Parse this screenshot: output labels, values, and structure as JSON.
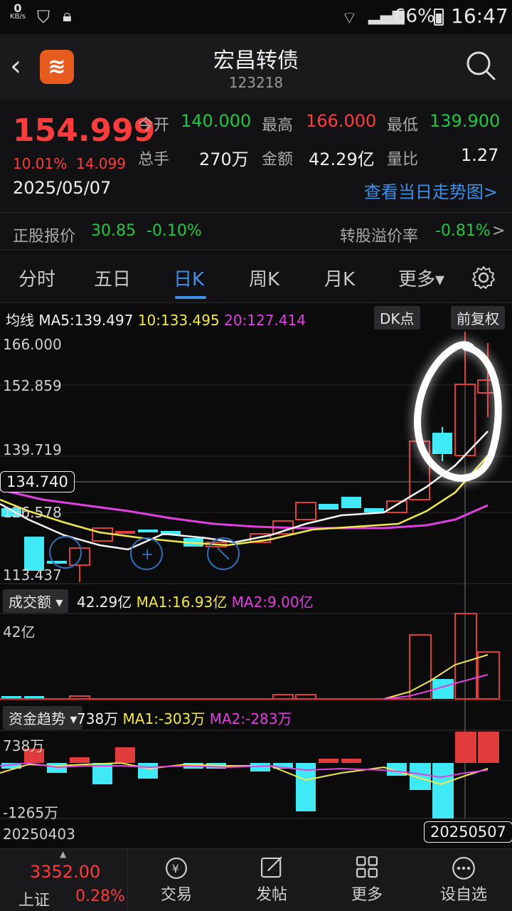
{
  "status": {
    "speed_value": "0",
    "speed_unit": "KB/s",
    "battery": "66%",
    "time": "16:47"
  },
  "header": {
    "title": "宏昌转债",
    "code": "123218"
  },
  "quote": {
    "price": "154.999",
    "change_pct": "10.01%",
    "change_amt": "14.099",
    "date": "2025/05/07",
    "open_label": "今开",
    "open": "140.000",
    "high_label": "最高",
    "high": "166.000",
    "low_label": "最低",
    "low": "139.900",
    "volume_label": "总手",
    "volume": "270万",
    "amount_label": "金额",
    "amount": "42.29亿",
    "ratio_label": "量比",
    "ratio": "1.27",
    "intraday_link": "查看当日走势图>",
    "stock_label": "正股报价",
    "stock_price": "30.85",
    "stock_change": "-0.10%",
    "premium_label": "转股溢价率",
    "premium": "-0.81%",
    "premium_arrow": ">"
  },
  "tabs": [
    {
      "label": "分时"
    },
    {
      "label": "五日"
    },
    {
      "label": "日K"
    },
    {
      "label": "周K"
    },
    {
      "label": "月K"
    },
    {
      "label": "更多▾"
    }
  ],
  "chart": {
    "ma_prefix": "均线",
    "ma5": "MA5:139.497",
    "ma10": "10:133.495",
    "ma20": "20:127.414",
    "dk_button": "DK点",
    "adjust_button": "前复权",
    "axis_labels": [
      "166.000",
      "152.859",
      "139.719",
      "126.578",
      "113.437"
    ],
    "crosshair_price": "134.740",
    "vol_selector": "成交额 ▾",
    "vol_value": "42.29亿",
    "vol_ma1": "MA1:16.93亿",
    "vol_ma2": "MA2:9.00亿",
    "vol_axis_top": "42亿",
    "flow_selector": "资金趋势 ▾",
    "flow_value": "738万",
    "flow_ma1": "MA1:-303万",
    "flow_ma2": "MA2:-283万",
    "flow_axis_top": "738万",
    "flow_axis_bottom": "-1265万",
    "date_start": "20250403",
    "date_end": "20250507"
  },
  "bottom": {
    "index_value": "3352.00",
    "index_name": "上证",
    "index_change": "0.28%",
    "items": [
      {
        "label": "交易"
      },
      {
        "label": "发帖"
      },
      {
        "label": "更多"
      },
      {
        "label": "设自选"
      }
    ]
  },
  "chart_data": {
    "type": "candlestick",
    "x": [
      "20250403",
      "20250507"
    ],
    "ylim": [
      113.437,
      166.0
    ],
    "ma": {
      "MA5": 139.497,
      "MA10": 133.495,
      "MA20": 127.414
    },
    "last": {
      "open": 140.0,
      "high": 166.0,
      "low": 139.9,
      "close": 154.999
    },
    "volume": {
      "last": "42.29亿",
      "MA1": "16.93亿",
      "MA2": "9.00亿"
    },
    "capital_flow": {
      "last": "738万",
      "MA1": "-303万",
      "MA2": "-283万",
      "range": [
        "-1265万",
        "738万"
      ]
    }
  }
}
